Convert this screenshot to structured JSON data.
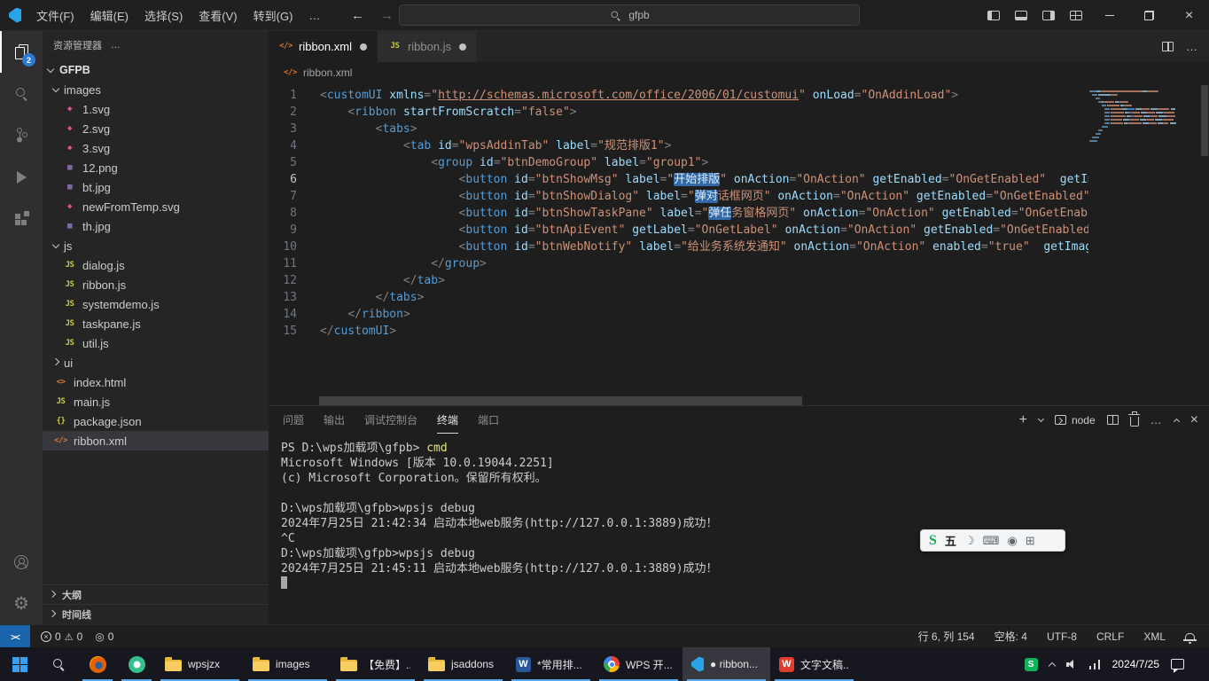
{
  "titlebar": {
    "menus": [
      "文件(F)",
      "编辑(E)",
      "选择(S)",
      "查看(V)",
      "转到(G)",
      "…"
    ],
    "search": "gfpb"
  },
  "activity": {
    "explorer_badge": "2"
  },
  "sidebar": {
    "title": "资源管理器",
    "root": "GFPB",
    "tree": [
      {
        "label": "images",
        "type": "folder",
        "depth": 0,
        "expanded": true
      },
      {
        "label": "1.svg",
        "type": "svg",
        "depth": 1
      },
      {
        "label": "2.svg",
        "type": "svg",
        "depth": 1
      },
      {
        "label": "3.svg",
        "type": "svg",
        "depth": 1
      },
      {
        "label": "12.png",
        "type": "image",
        "depth": 1
      },
      {
        "label": "bt.jpg",
        "type": "image",
        "depth": 1
      },
      {
        "label": "newFromTemp.svg",
        "type": "svg",
        "depth": 1
      },
      {
        "label": "th.jpg",
        "type": "image",
        "depth": 1
      },
      {
        "label": "js",
        "type": "folder",
        "depth": 0,
        "expanded": true
      },
      {
        "label": "dialog.js",
        "type": "js",
        "depth": 1
      },
      {
        "label": "ribbon.js",
        "type": "js",
        "depth": 1
      },
      {
        "label": "systemdemo.js",
        "type": "js",
        "depth": 1
      },
      {
        "label": "taskpane.js",
        "type": "js",
        "depth": 1
      },
      {
        "label": "util.js",
        "type": "js",
        "depth": 1
      },
      {
        "label": "ui",
        "type": "folder",
        "depth": 0,
        "expanded": false
      },
      {
        "label": "index.html",
        "type": "html",
        "depth": 0
      },
      {
        "label": "main.js",
        "type": "js",
        "depth": 0
      },
      {
        "label": "package.json",
        "type": "json",
        "depth": 0
      },
      {
        "label": "ribbon.xml",
        "type": "xml",
        "depth": 0,
        "selected": true
      }
    ],
    "bottom": [
      "大纲",
      "时间线"
    ]
  },
  "file_icons": {
    "js": {
      "glyph": "JS",
      "color": "#cbcb41"
    },
    "svg": {
      "glyph": "◆",
      "color": "#e0559a"
    },
    "image": {
      "glyph": "▦",
      "color": "#9b7cc9"
    },
    "html": {
      "glyph": "<>",
      "color": "#e37933"
    },
    "json": {
      "glyph": "{}",
      "color": "#cbcb41"
    },
    "xml": {
      "glyph": "</>",
      "color": "#e37933"
    }
  },
  "editor": {
    "tabs": [
      {
        "label": "ribbon.xml",
        "type": "xml",
        "active": true,
        "modified": true
      },
      {
        "label": "ribbon.js",
        "type": "js",
        "active": false,
        "modified": true
      }
    ],
    "breadcrumb": "ribbon.xml",
    "breadcrumb_type": "xml",
    "active_line": 6,
    "lines": [
      {
        "n": 1,
        "s": [
          [
            "<",
            "p"
          ],
          [
            "customUI",
            "t"
          ],
          [
            " ",
            "w"
          ],
          [
            "xmlns",
            "a"
          ],
          [
            "=",
            "p"
          ],
          [
            "\"",
            "s"
          ],
          [
            "http://schemas.microsoft.com/office/2006/01/customui",
            "u"
          ],
          [
            "\"",
            "s"
          ],
          [
            " ",
            "w"
          ],
          [
            "onLoad",
            "a"
          ],
          [
            "=",
            "p"
          ],
          [
            "\"OnAddinLoad\"",
            "s"
          ],
          [
            ">",
            "p"
          ]
        ]
      },
      {
        "n": 2,
        "s": [
          [
            "    ",
            "w"
          ],
          [
            "<",
            "p"
          ],
          [
            "ribbon",
            "t"
          ],
          [
            " ",
            "w"
          ],
          [
            "startFromScratch",
            "a"
          ],
          [
            "=",
            "p"
          ],
          [
            "\"false\"",
            "s"
          ],
          [
            ">",
            "p"
          ]
        ]
      },
      {
        "n": 3,
        "s": [
          [
            "        ",
            "w"
          ],
          [
            "<",
            "p"
          ],
          [
            "tabs",
            "t"
          ],
          [
            ">",
            "p"
          ]
        ]
      },
      {
        "n": 4,
        "s": [
          [
            "            ",
            "w"
          ],
          [
            "<",
            "p"
          ],
          [
            "tab",
            "t"
          ],
          [
            " ",
            "w"
          ],
          [
            "id",
            "a"
          ],
          [
            "=",
            "p"
          ],
          [
            "\"wpsAddinTab\"",
            "s"
          ],
          [
            " ",
            "w"
          ],
          [
            "label",
            "a"
          ],
          [
            "=",
            "p"
          ],
          [
            "\"规范排版1\"",
            "s"
          ],
          [
            ">",
            "p"
          ]
        ]
      },
      {
        "n": 5,
        "s": [
          [
            "                ",
            "w"
          ],
          [
            "<",
            "p"
          ],
          [
            "group",
            "t"
          ],
          [
            " ",
            "w"
          ],
          [
            "id",
            "a"
          ],
          [
            "=",
            "p"
          ],
          [
            "\"btnDemoGroup\"",
            "s"
          ],
          [
            " ",
            "w"
          ],
          [
            "label",
            "a"
          ],
          [
            "=",
            "p"
          ],
          [
            "\"group1\"",
            "s"
          ],
          [
            ">",
            "p"
          ]
        ]
      },
      {
        "n": 6,
        "s": [
          [
            "                    ",
            "w"
          ],
          [
            "<",
            "p"
          ],
          [
            "button",
            "t"
          ],
          [
            " ",
            "w"
          ],
          [
            "id",
            "a"
          ],
          [
            "=",
            "p"
          ],
          [
            "\"btnShowMsg\"",
            "s"
          ],
          [
            " ",
            "w"
          ],
          [
            "label",
            "a"
          ],
          [
            "=",
            "p"
          ],
          [
            "\"",
            "s"
          ],
          [
            "开始排版",
            "h"
          ],
          [
            "\"",
            "s"
          ],
          [
            " ",
            "w"
          ],
          [
            "onAction",
            "a"
          ],
          [
            "=",
            "p"
          ],
          [
            "\"OnAction\"",
            "s"
          ],
          [
            " ",
            "w"
          ],
          [
            "getEnabled",
            "a"
          ],
          [
            "=",
            "p"
          ],
          [
            "\"OnGetEnabled\"",
            "s"
          ],
          [
            "  ",
            "w"
          ],
          [
            "getIma",
            "a"
          ]
        ]
      },
      {
        "n": 7,
        "s": [
          [
            "                    ",
            "w"
          ],
          [
            "<",
            "p"
          ],
          [
            "button",
            "t"
          ],
          [
            " ",
            "w"
          ],
          [
            "id",
            "a"
          ],
          [
            "=",
            "p"
          ],
          [
            "\"btnShowDialog\"",
            "s"
          ],
          [
            " ",
            "w"
          ],
          [
            "label",
            "a"
          ],
          [
            "=",
            "p"
          ],
          [
            "\"",
            "s"
          ],
          [
            "弹对",
            "h"
          ],
          [
            "话框网页\"",
            "s"
          ],
          [
            " ",
            "w"
          ],
          [
            "onAction",
            "a"
          ],
          [
            "=",
            "p"
          ],
          [
            "\"OnAction\"",
            "s"
          ],
          [
            " ",
            "w"
          ],
          [
            "getEnabled",
            "a"
          ],
          [
            "=",
            "p"
          ],
          [
            "\"OnGetEnabled\"",
            "s"
          ]
        ]
      },
      {
        "n": 8,
        "s": [
          [
            "                    ",
            "w"
          ],
          [
            "<",
            "p"
          ],
          [
            "button",
            "t"
          ],
          [
            " ",
            "w"
          ],
          [
            "id",
            "a"
          ],
          [
            "=",
            "p"
          ],
          [
            "\"btnShowTaskPane\"",
            "s"
          ],
          [
            " ",
            "w"
          ],
          [
            "label",
            "a"
          ],
          [
            "=",
            "p"
          ],
          [
            "\"",
            "s"
          ],
          [
            "弹任",
            "h"
          ],
          [
            "务窗格网页\"",
            "s"
          ],
          [
            " ",
            "w"
          ],
          [
            "onAction",
            "a"
          ],
          [
            "=",
            "p"
          ],
          [
            "\"OnAction\"",
            "s"
          ],
          [
            " ",
            "w"
          ],
          [
            "getEnabled",
            "a"
          ],
          [
            "=",
            "p"
          ],
          [
            "\"OnGetEnabl",
            "s"
          ]
        ]
      },
      {
        "n": 9,
        "s": [
          [
            "                    ",
            "w"
          ],
          [
            "<",
            "p"
          ],
          [
            "button",
            "t"
          ],
          [
            " ",
            "w"
          ],
          [
            "id",
            "a"
          ],
          [
            "=",
            "p"
          ],
          [
            "\"btnApiEvent\"",
            "s"
          ],
          [
            " ",
            "w"
          ],
          [
            "getLabel",
            "a"
          ],
          [
            "=",
            "p"
          ],
          [
            "\"OnGetLabel\"",
            "s"
          ],
          [
            " ",
            "w"
          ],
          [
            "onAction",
            "a"
          ],
          [
            "=",
            "p"
          ],
          [
            "\"OnAction\"",
            "s"
          ],
          [
            " ",
            "w"
          ],
          [
            "getEnabled",
            "a"
          ],
          [
            "=",
            "p"
          ],
          [
            "\"OnGetEnabled\"",
            "s"
          ]
        ]
      },
      {
        "n": 10,
        "s": [
          [
            "                    ",
            "w"
          ],
          [
            "<",
            "p"
          ],
          [
            "button",
            "t"
          ],
          [
            " ",
            "w"
          ],
          [
            "id",
            "a"
          ],
          [
            "=",
            "p"
          ],
          [
            "\"btnWebNotify\"",
            "s"
          ],
          [
            " ",
            "w"
          ],
          [
            "label",
            "a"
          ],
          [
            "=",
            "p"
          ],
          [
            "\"给业务系统发通知\"",
            "s"
          ],
          [
            " ",
            "w"
          ],
          [
            "onAction",
            "a"
          ],
          [
            "=",
            "p"
          ],
          [
            "\"OnAction\"",
            "s"
          ],
          [
            " ",
            "w"
          ],
          [
            "enabled",
            "a"
          ],
          [
            "=",
            "p"
          ],
          [
            "\"true\"",
            "s"
          ],
          [
            "  ",
            "w"
          ],
          [
            "getImage",
            "a"
          ]
        ]
      },
      {
        "n": 11,
        "s": [
          [
            "                ",
            "w"
          ],
          [
            "</",
            "p"
          ],
          [
            "group",
            "t"
          ],
          [
            ">",
            "p"
          ]
        ]
      },
      {
        "n": 12,
        "s": [
          [
            "            ",
            "w"
          ],
          [
            "</",
            "p"
          ],
          [
            "tab",
            "t"
          ],
          [
            ">",
            "p"
          ]
        ]
      },
      {
        "n": 13,
        "s": [
          [
            "        ",
            "w"
          ],
          [
            "</",
            "p"
          ],
          [
            "tabs",
            "t"
          ],
          [
            ">",
            "p"
          ]
        ]
      },
      {
        "n": 14,
        "s": [
          [
            "    ",
            "w"
          ],
          [
            "</",
            "p"
          ],
          [
            "ribbon",
            "t"
          ],
          [
            ">",
            "p"
          ]
        ]
      },
      {
        "n": 15,
        "s": [
          [
            "</",
            "p"
          ],
          [
            "customUI",
            "t"
          ],
          [
            ">",
            "p"
          ]
        ]
      }
    ]
  },
  "panel": {
    "tabs": [
      {
        "label": "问题"
      },
      {
        "label": "输出"
      },
      {
        "label": "调试控制台"
      },
      {
        "label": "终端",
        "active": true
      },
      {
        "label": "端口"
      }
    ],
    "terminal_profile": "node",
    "terminal": [
      {
        "s": [
          [
            "PS D:\\wps加载项\\gfpb> ",
            "w"
          ],
          [
            "cmd",
            "y"
          ]
        ]
      },
      {
        "s": [
          [
            "Microsoft Windows [版本 10.0.19044.2251]",
            "w"
          ]
        ]
      },
      {
        "s": [
          [
            "(c) Microsoft Corporation。保留所有权利。",
            "w"
          ]
        ]
      },
      {
        "s": []
      },
      {
        "s": [
          [
            "D:\\wps加载项\\gfpb>wpsjs debug",
            "w"
          ]
        ]
      },
      {
        "s": [
          [
            "2024年7月25日 21:42:34 启动本地web服务(http://127.0.0.1:3889)成功！",
            "w"
          ]
        ]
      },
      {
        "s": [
          [
            "^C",
            "w"
          ]
        ]
      },
      {
        "s": [
          [
            "D:\\wps加载项\\gfpb>wpsjs debug",
            "w"
          ]
        ]
      },
      {
        "s": [
          [
            "2024年7月25日 21:45:11 启动本地web服务(http://127.0.0.1:3889)成功！",
            "w"
          ]
        ]
      },
      {
        "s": [],
        "cursor": true
      }
    ]
  },
  "status": {
    "errors": "0",
    "warnings": "0",
    "extra": "0",
    "cursor": "行 6, 列 154",
    "indent": "空格: 4",
    "encoding": "UTF-8",
    "eol": "CRLF",
    "lang": "XML"
  },
  "ime": {
    "logo": "S",
    "mode": "五",
    "icons": [
      {
        "name": "ime-moon-icon",
        "glyph": "moon"
      },
      {
        "name": "ime-keyboard-icon",
        "glyph": "kbd"
      },
      {
        "name": "ime-user-icon",
        "glyph": "user"
      },
      {
        "name": "ime-toolbox-icon",
        "glyph": "grid"
      }
    ]
  },
  "app_icons": {
    "word": {
      "glyph": "W",
      "bg": "#2b579a",
      "fg": "#ffffff"
    },
    "wps": {
      "glyph": "W",
      "bg": "#e23c2e",
      "fg": "#ffffff"
    },
    "sogou": {
      "glyph": "S",
      "bg": "#12b25c",
      "fg": "#ffffff"
    }
  },
  "taskbar": {
    "buttons": [
      {
        "name": "start",
        "icon": "windows"
      },
      {
        "name": "search",
        "icon": "search"
      },
      {
        "name": "firefox",
        "icon": "firefox",
        "running": true
      },
      {
        "name": "browser",
        "icon": "browser",
        "running": true
      },
      {
        "name": "folder-wpsjzx",
        "icon": "folder",
        "label": "wpsjzx",
        "running": true
      },
      {
        "name": "folder-images",
        "icon": "folder",
        "label": "images",
        "running": true
      },
      {
        "name": "folder-free",
        "icon": "folder",
        "label": "【免费】...",
        "running": true
      },
      {
        "name": "folder-jsaddons",
        "icon": "folder",
        "label": "jsaddons",
        "running": true
      },
      {
        "name": "word-doc",
        "icon": "word",
        "label": "*常用排...",
        "running": true
      },
      {
        "name": "chrome",
        "icon": "chrome",
        "label": "WPS 开...",
        "running": true
      },
      {
        "name": "vscode",
        "icon": "vscode",
        "label": "● ribbon...",
        "active": true,
        "running": true
      },
      {
        "name": "wps-writer",
        "icon": "wps",
        "label": "文字文稿...",
        "running": true
      }
    ],
    "tray": [
      {
        "name": "sogou-tray",
        "icon": "sogou"
      },
      {
        "name": "tray-expand",
        "icon": "chevup"
      },
      {
        "name": "volume",
        "icon": "speaker"
      },
      {
        "name": "network",
        "icon": "net"
      }
    ],
    "tray_date": "2024/7/25"
  }
}
